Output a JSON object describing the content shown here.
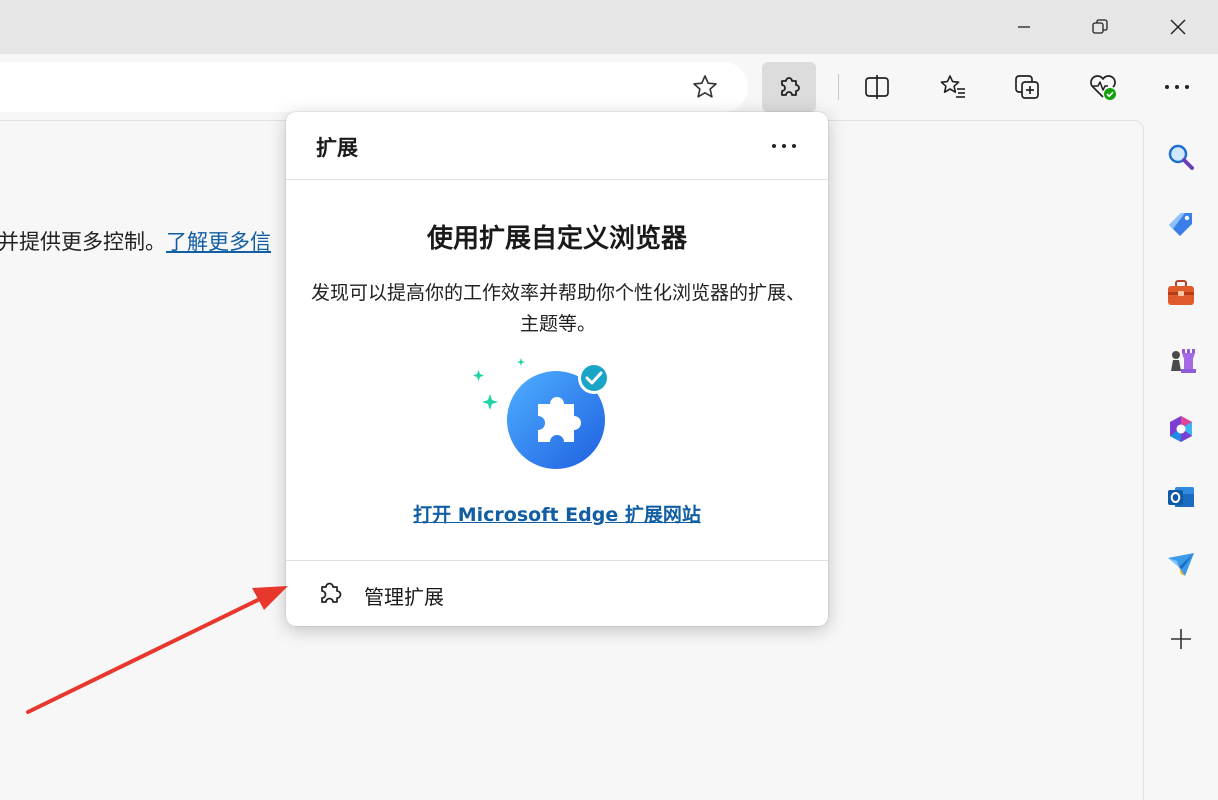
{
  "window": {
    "controls": [
      "minimize-icon",
      "restore-icon",
      "close-icon"
    ]
  },
  "toolbar": {
    "favorite_icon": "star-icon",
    "buttons": [
      "extensions-icon",
      "split-screen-icon",
      "favorites-icon",
      "collections-icon",
      "browser-essentials-icon",
      "more-icon"
    ]
  },
  "page": {
    "text": "并提供更多控制。",
    "link": "了解更多信"
  },
  "popup": {
    "title": "扩展",
    "more_label": "···",
    "heading": "使用扩展自定义浏览器",
    "body": "发现可以提高你的工作效率并帮助你个性化浏览器的扩展、主题等。",
    "store_link": "打开 Microsoft Edge 扩展网站",
    "manage_label": "管理扩展"
  },
  "sidebar": {
    "items": [
      "search-icon",
      "shopping-tag-icon",
      "tools-icon",
      "games-icon",
      "microsoft-365-icon",
      "outlook-icon",
      "drop-icon",
      "add-icon"
    ]
  },
  "colors": {
    "accent_link": "#115ea3",
    "annotation_arrow": "#e8382e"
  }
}
